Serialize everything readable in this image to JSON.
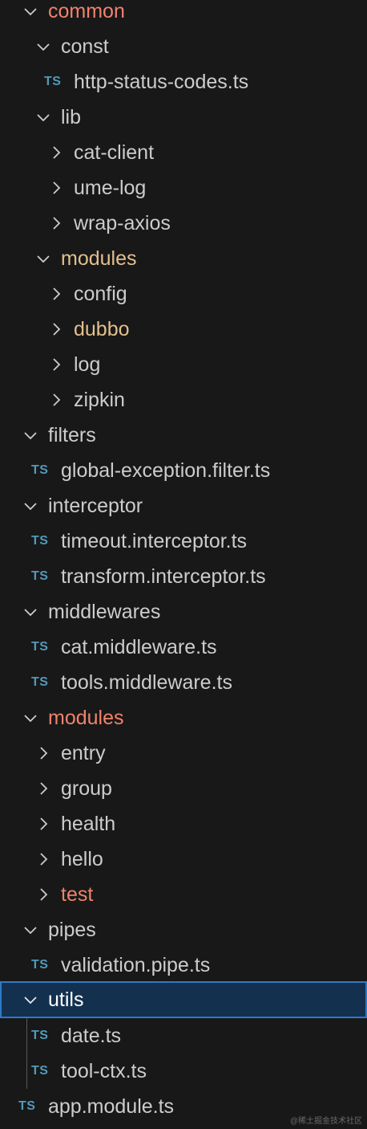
{
  "colors": {
    "background": "#181818",
    "text_default": "#cccccc",
    "text_modified": "#e2c08d",
    "text_error": "#f0826c",
    "ts_icon": "#519aba",
    "selection_bg": "#13314f",
    "selection_border": "#2f79c8"
  },
  "tree": [
    {
      "label": "common",
      "type": "folder",
      "expanded": true,
      "color": "red"
    },
    {
      "label": "const",
      "type": "folder",
      "expanded": true,
      "color": "default"
    },
    {
      "label": "http-status-codes.ts",
      "type": "file",
      "icon": "TS",
      "color": "default"
    },
    {
      "label": "lib",
      "type": "folder",
      "expanded": true,
      "color": "default"
    },
    {
      "label": "cat-client",
      "type": "folder",
      "expanded": false,
      "color": "default"
    },
    {
      "label": "ume-log",
      "type": "folder",
      "expanded": false,
      "color": "default"
    },
    {
      "label": "wrap-axios",
      "type": "folder",
      "expanded": false,
      "color": "default"
    },
    {
      "label": "modules",
      "type": "folder",
      "expanded": true,
      "color": "yellow"
    },
    {
      "label": "config",
      "type": "folder",
      "expanded": false,
      "color": "default"
    },
    {
      "label": "dubbo",
      "type": "folder",
      "expanded": false,
      "color": "yellow"
    },
    {
      "label": "log",
      "type": "folder",
      "expanded": false,
      "color": "default"
    },
    {
      "label": "zipkin",
      "type": "folder",
      "expanded": false,
      "color": "default"
    },
    {
      "label": "filters",
      "type": "folder",
      "expanded": true,
      "color": "default"
    },
    {
      "label": "global-exception.filter.ts",
      "type": "file",
      "icon": "TS",
      "color": "default"
    },
    {
      "label": "interceptor",
      "type": "folder",
      "expanded": true,
      "color": "default"
    },
    {
      "label": "timeout.interceptor.ts",
      "type": "file",
      "icon": "TS",
      "color": "default"
    },
    {
      "label": "transform.interceptor.ts",
      "type": "file",
      "icon": "TS",
      "color": "default"
    },
    {
      "label": "middlewares",
      "type": "folder",
      "expanded": true,
      "color": "default"
    },
    {
      "label": "cat.middleware.ts",
      "type": "file",
      "icon": "TS",
      "color": "default"
    },
    {
      "label": "tools.middleware.ts",
      "type": "file",
      "icon": "TS",
      "color": "default"
    },
    {
      "label": "modules",
      "type": "folder",
      "expanded": true,
      "color": "red"
    },
    {
      "label": "entry",
      "type": "folder",
      "expanded": false,
      "color": "default"
    },
    {
      "label": "group",
      "type": "folder",
      "expanded": false,
      "color": "default"
    },
    {
      "label": "health",
      "type": "folder",
      "expanded": false,
      "color": "default"
    },
    {
      "label": "hello",
      "type": "folder",
      "expanded": false,
      "color": "default"
    },
    {
      "label": "test",
      "type": "folder",
      "expanded": false,
      "color": "red"
    },
    {
      "label": "pipes",
      "type": "folder",
      "expanded": true,
      "color": "default"
    },
    {
      "label": "validation.pipe.ts",
      "type": "file",
      "icon": "TS",
      "color": "default"
    },
    {
      "label": "utils",
      "type": "folder",
      "expanded": true,
      "color": "default",
      "selected": true
    },
    {
      "label": "date.ts",
      "type": "file",
      "icon": "TS",
      "color": "default"
    },
    {
      "label": "tool-ctx.ts",
      "type": "file",
      "icon": "TS",
      "color": "default"
    },
    {
      "label": "app.module.ts",
      "type": "file",
      "icon": "TS",
      "color": "default"
    }
  ],
  "watermark": "@稀土掘金技术社区"
}
